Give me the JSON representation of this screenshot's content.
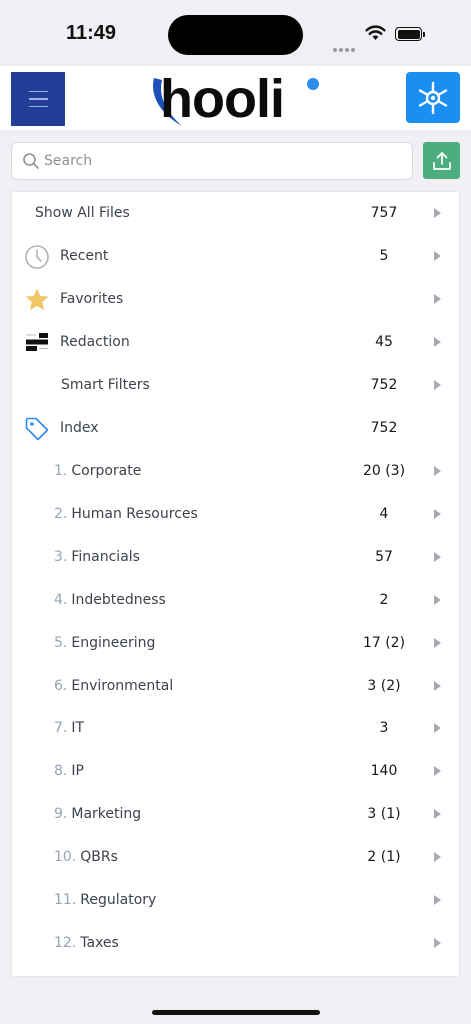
{
  "status_bar": {
    "time": "11:49"
  },
  "header": {
    "logo_text": "hooli",
    "colors": {
      "menu_bg": "#223e96",
      "vault_bg": "#1a8ef1",
      "logo_accent": "#2f8ceb"
    },
    "menu_icon": "hamburger-icon",
    "vault_icon": "vault-wheel-icon"
  },
  "search": {
    "placeholder": "Search",
    "value": "",
    "upload_icon": "upload-icon",
    "upload_color": "#4cae7f"
  },
  "list": {
    "items": [
      {
        "label": "Show All Files",
        "count": "757",
        "chevron": true,
        "icon": ""
      },
      {
        "label": "Recent",
        "count": "5",
        "chevron": true,
        "icon": "clock-icon"
      },
      {
        "label": "Favorites",
        "count": "",
        "chevron": true,
        "icon": "star-icon"
      },
      {
        "label": "Redaction",
        "count": "45",
        "chevron": true,
        "icon": "redaction-icon"
      },
      {
        "label": "Smart Filters",
        "count": "752",
        "chevron": true,
        "icon": ""
      },
      {
        "label": "Index",
        "count": "752",
        "chevron": false,
        "icon": "tag-icon"
      },
      {
        "num": "1.",
        "label": "Corporate",
        "count": "20 (3)",
        "chevron": true
      },
      {
        "num": "2.",
        "label": "Human Resources",
        "count": "4",
        "chevron": true
      },
      {
        "num": "3.",
        "label": "Financials",
        "count": "57",
        "chevron": true
      },
      {
        "num": "4.",
        "label": "Indebtedness",
        "count": "2",
        "chevron": true
      },
      {
        "num": "5.",
        "label": "Engineering",
        "count": "17 (2)",
        "chevron": true
      },
      {
        "num": "6.",
        "label": "Environmental",
        "count": "3 (2)",
        "chevron": true
      },
      {
        "num": "7.",
        "label": "IT",
        "count": "3",
        "chevron": true
      },
      {
        "num": "8.",
        "label": "IP",
        "count": "140",
        "chevron": true
      },
      {
        "num": "9.",
        "label": "Marketing",
        "count": "3 (1)",
        "chevron": true
      },
      {
        "num": "10.",
        "label": "QBRs",
        "count": "2 (1)",
        "chevron": true
      },
      {
        "num": "11.",
        "label": "Regulatory",
        "count": "",
        "chevron": true
      },
      {
        "num": "12.",
        "label": "Taxes",
        "count": "",
        "chevron": true
      }
    ]
  }
}
